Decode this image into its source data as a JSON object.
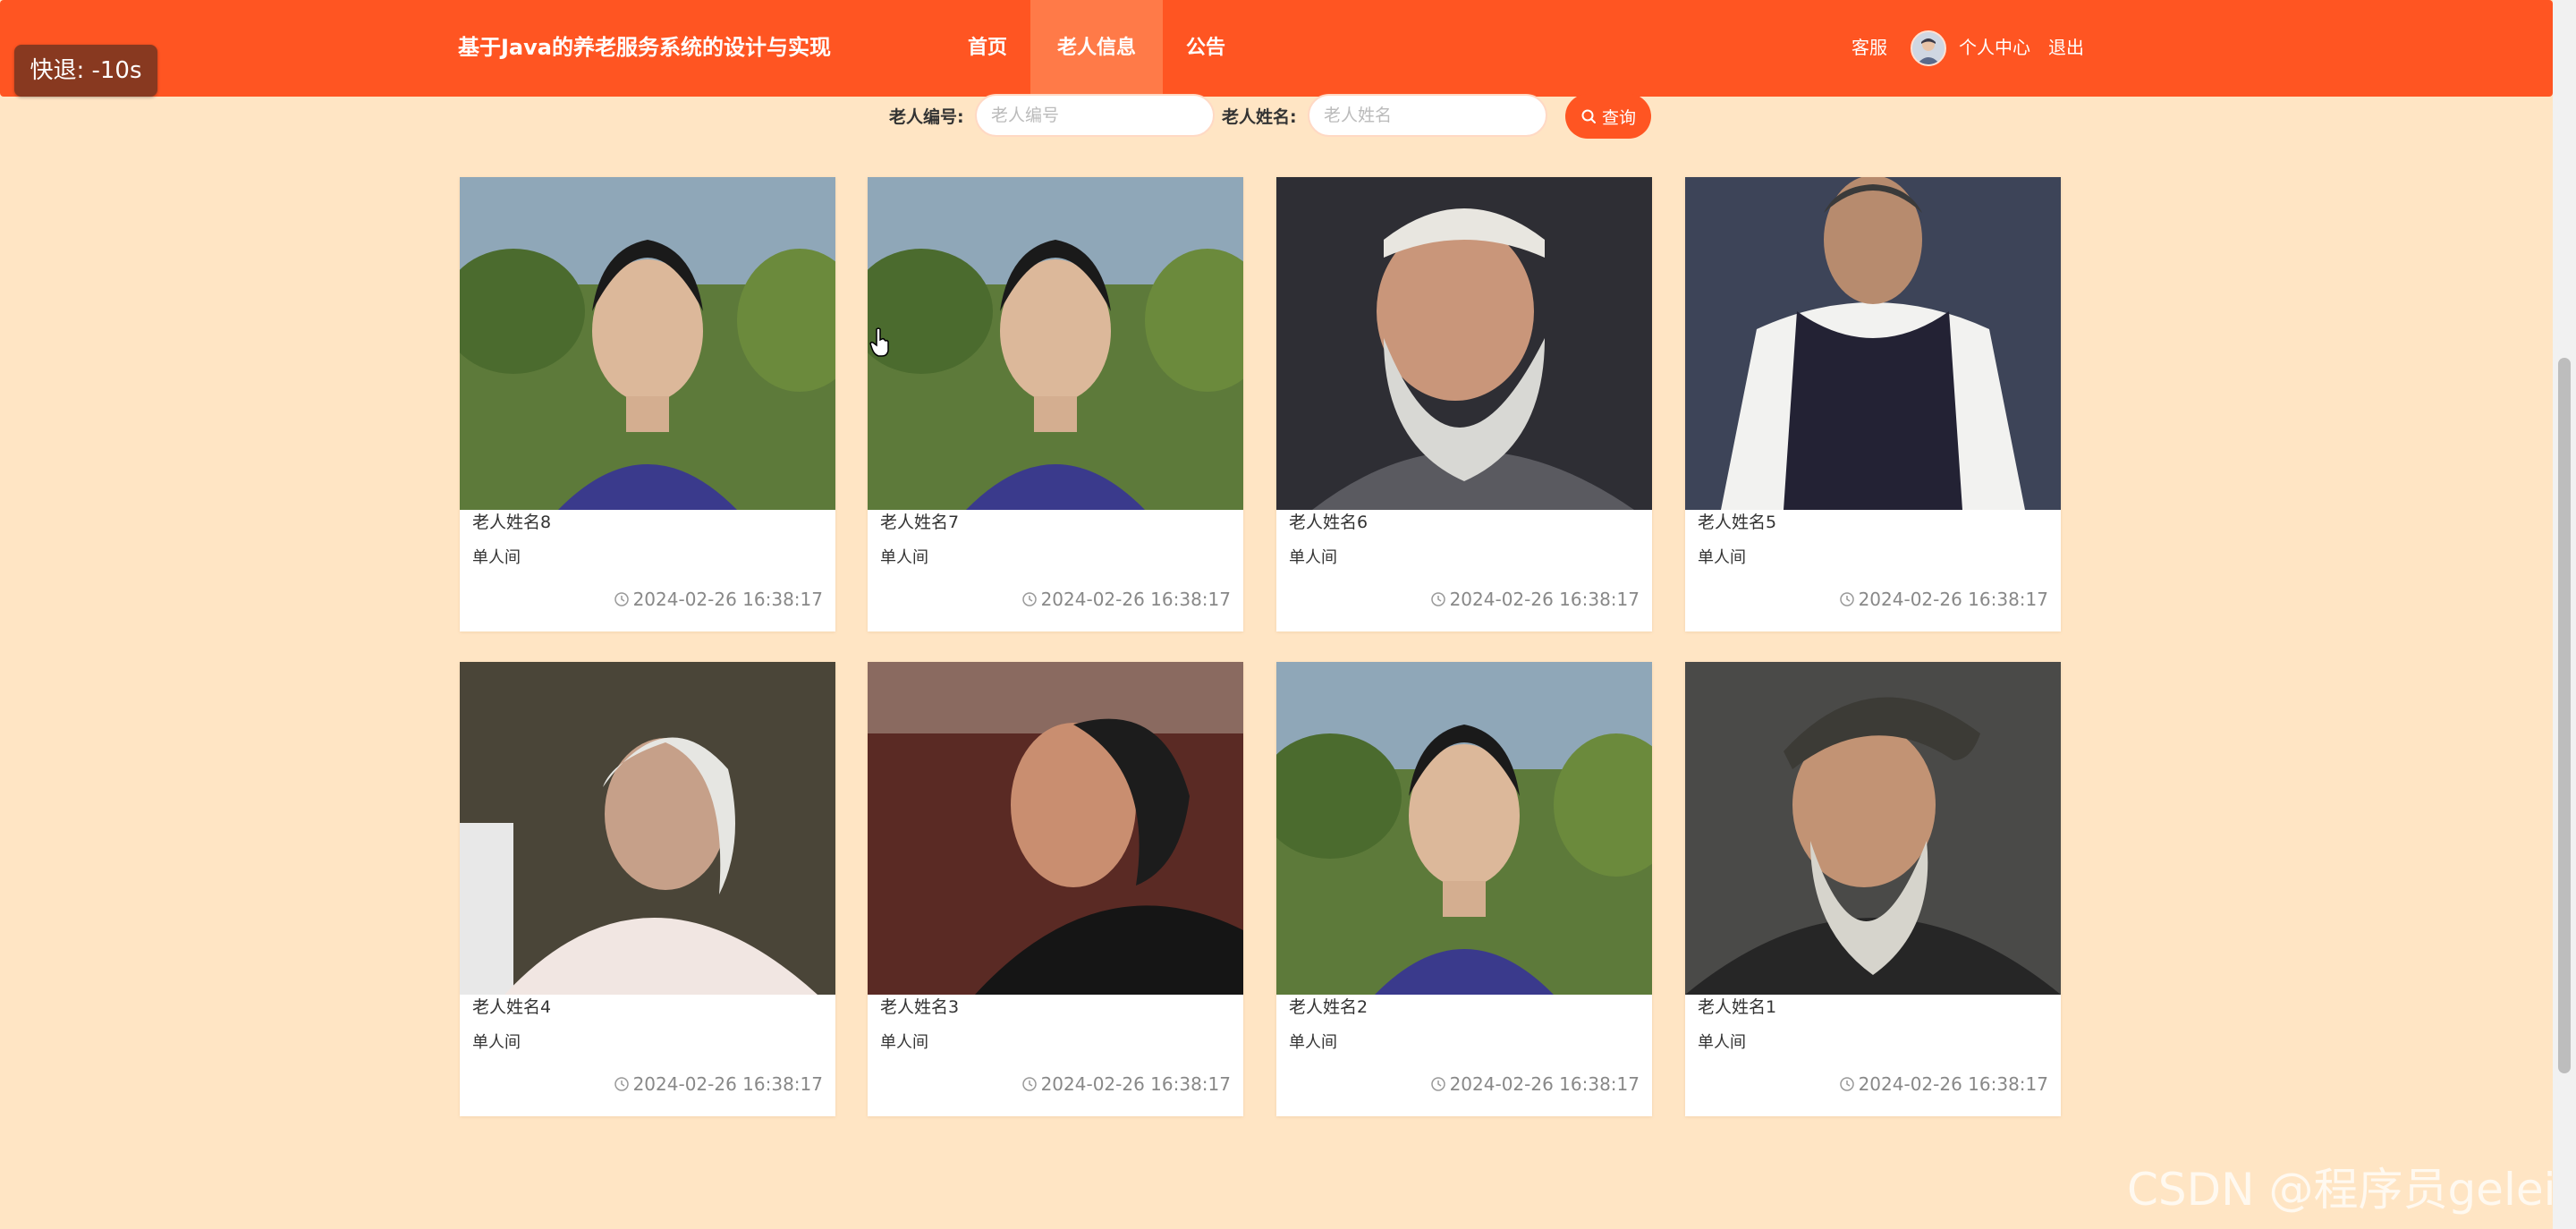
{
  "header": {
    "site_title": "基于Java的养老服务系统的设计与实现",
    "nav": [
      {
        "label": "首页",
        "active": false
      },
      {
        "label": "老人信息",
        "active": true
      },
      {
        "label": "公告",
        "active": false
      }
    ],
    "customer_service": "客服",
    "personal_center": "个人中心",
    "logout": "退出"
  },
  "player": {
    "rewind_label": "快退: -10s"
  },
  "search": {
    "id_label": "老人编号:",
    "id_placeholder": "老人编号",
    "name_label": "老人姓名:",
    "name_placeholder": "老人姓名",
    "button_label": "查询"
  },
  "cards": [
    {
      "name": "老人姓名8",
      "room": "单人间",
      "time": "2024-02-26 16:38:17",
      "photo": "woman-purple-jacket"
    },
    {
      "name": "老人姓名7",
      "room": "单人间",
      "time": "2024-02-26 16:38:17",
      "photo": "woman-purple-jacket"
    },
    {
      "name": "老人姓名6",
      "room": "单人间",
      "time": "2024-02-26 16:38:17",
      "photo": "bearded-man-white-cap"
    },
    {
      "name": "老人姓名5",
      "room": "单人间",
      "time": "2024-02-26 16:38:17",
      "photo": "woman-dark-vest"
    },
    {
      "name": "老人姓名4",
      "room": "单人间",
      "time": "2024-02-26 16:38:17",
      "photo": "white-haired-woman"
    },
    {
      "name": "老人姓名3",
      "room": "单人间",
      "time": "2024-02-26 16:38:17",
      "photo": "smiling-old-woman-black-hat"
    },
    {
      "name": "老人姓名2",
      "room": "单人间",
      "time": "2024-02-26 16:38:17",
      "photo": "woman-purple-jacket"
    },
    {
      "name": "老人姓名1",
      "room": "单人间",
      "time": "2024-02-26 16:38:17",
      "photo": "old-man-cap-beard"
    }
  ],
  "watermark": "CSDN @程序员gelei",
  "colors": {
    "accent": "#ff5522",
    "page_background": "#ffe5c4",
    "nav_active": "#ff7a48"
  }
}
